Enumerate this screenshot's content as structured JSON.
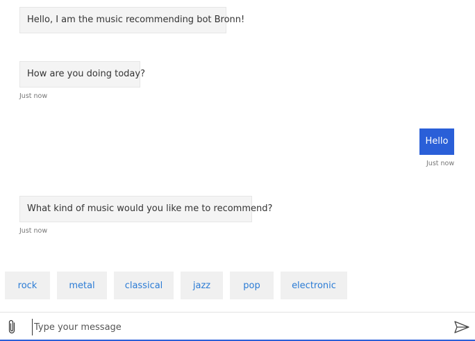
{
  "messages": [
    {
      "from": "bot",
      "text": "Hello, I am the music recommending bot Bronn!"
    },
    {
      "from": "bot",
      "text": "How are you doing today?",
      "timestamp": "Just now"
    },
    {
      "from": "user",
      "text": "Hello",
      "timestamp": "Just now"
    },
    {
      "from": "bot",
      "text": "What kind of music would you like me to recommend?",
      "timestamp": "Just now"
    }
  ],
  "suggested_actions": [
    {
      "label": "rock"
    },
    {
      "label": "metal"
    },
    {
      "label": "classical"
    },
    {
      "label": "jazz"
    },
    {
      "label": "pop"
    },
    {
      "label": "electronic"
    }
  ],
  "input": {
    "placeholder": "Type your message",
    "value": ""
  },
  "icons": {
    "attach": "paperclip-icon",
    "send": "send-icon"
  },
  "colors": {
    "user_bubble": "#2a5fd8",
    "bot_bubble": "#f4f4f4",
    "chip_text": "#2a7bd5",
    "input_underline": "#2a5fd8"
  }
}
